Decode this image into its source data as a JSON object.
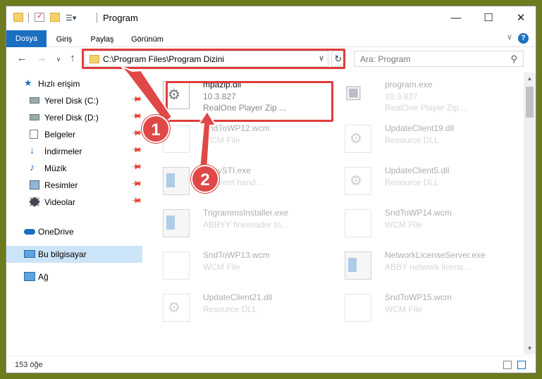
{
  "window": {
    "title": "Program",
    "controls": {
      "minimize": "—",
      "maximize": "☐",
      "close": "✕"
    }
  },
  "ribbon": {
    "tabs": [
      "Dosya",
      "Giriş",
      "Paylaş",
      "Görünüm"
    ],
    "help": "?"
  },
  "address": {
    "path": "C:\\Program Files\\Program Dizini",
    "search_placeholder": "Ara: Program"
  },
  "sidebar": {
    "items": [
      {
        "label": "Hızlı erişim",
        "icon": "star-icon"
      },
      {
        "label": "Yerel Disk (C:)",
        "icon": "drive-icon",
        "pinned": true
      },
      {
        "label": "Yerel Disk (D:)",
        "icon": "drive-icon",
        "pinned": true
      },
      {
        "label": "Belgeler",
        "icon": "documents-icon",
        "pinned": true
      },
      {
        "label": "İndirmeler",
        "icon": "download-icon",
        "pinned": true
      },
      {
        "label": "Müzik",
        "icon": "music-icon",
        "pinned": true
      },
      {
        "label": "Resimler",
        "icon": "pictures-icon",
        "pinned": true
      },
      {
        "label": "Videolar",
        "icon": "videos-icon",
        "pinned": true
      },
      {
        "label": "OneDrive",
        "icon": "cloud-icon"
      },
      {
        "label": "Bu bilgisayar",
        "icon": "computer-icon",
        "selected": true
      },
      {
        "label": "Ağ",
        "icon": "network-icon"
      }
    ]
  },
  "files": [
    {
      "name": "mpazip.dll",
      "line1": "10.3.827",
      "line2": "RealOne Player Zip ...",
      "icon": "dll-gear-icon"
    },
    {
      "name": "program.exe",
      "line1": "10.3.827",
      "line2": "RealOne Player Zip ...",
      "icon": "exe-icon"
    },
    {
      "name": "SndToWP12.wcm",
      "line1": "WCM File",
      "line2": "",
      "icon": "document-icon"
    },
    {
      "name": "UpdateClient19.dll",
      "line1": "Resource DLL",
      "line2": "",
      "icon": "dll-gear-icon"
    },
    {
      "name": "EasySTI.exe",
      "line1": "sti event hand...",
      "line2": "",
      "icon": "window-app-icon"
    },
    {
      "name": "UpdateClient5.dll",
      "line1": "Resource DLL",
      "line2": "",
      "icon": "dll-gear-icon"
    },
    {
      "name": "TrigrammsInstaller.exe",
      "line1": "ABBYY finereader tri...",
      "line2": "",
      "icon": "window-app-icon"
    },
    {
      "name": "SndToWP14.wcm",
      "line1": "WCM File",
      "line2": "",
      "icon": "document-icon"
    },
    {
      "name": "SndToWP13.wcm",
      "line1": "WCM File",
      "line2": "",
      "icon": "document-icon"
    },
    {
      "name": "NetworkLicenseServer.exe",
      "line1": "ABBY network licens...",
      "line2": "",
      "icon": "window-app-icon"
    },
    {
      "name": "UpdateClient21.dll",
      "line1": "Resource DLL",
      "line2": "",
      "icon": "dll-gear-icon"
    },
    {
      "name": "SndToWP15.wcm",
      "line1": "WCM File",
      "line2": "",
      "icon": "document-icon"
    }
  ],
  "status": {
    "count": "153 öğe"
  },
  "callouts": [
    "1",
    "2"
  ],
  "colors": {
    "accent": "#1a6fc1",
    "highlight": "#e03c3c",
    "selected": "#cce4f7"
  }
}
